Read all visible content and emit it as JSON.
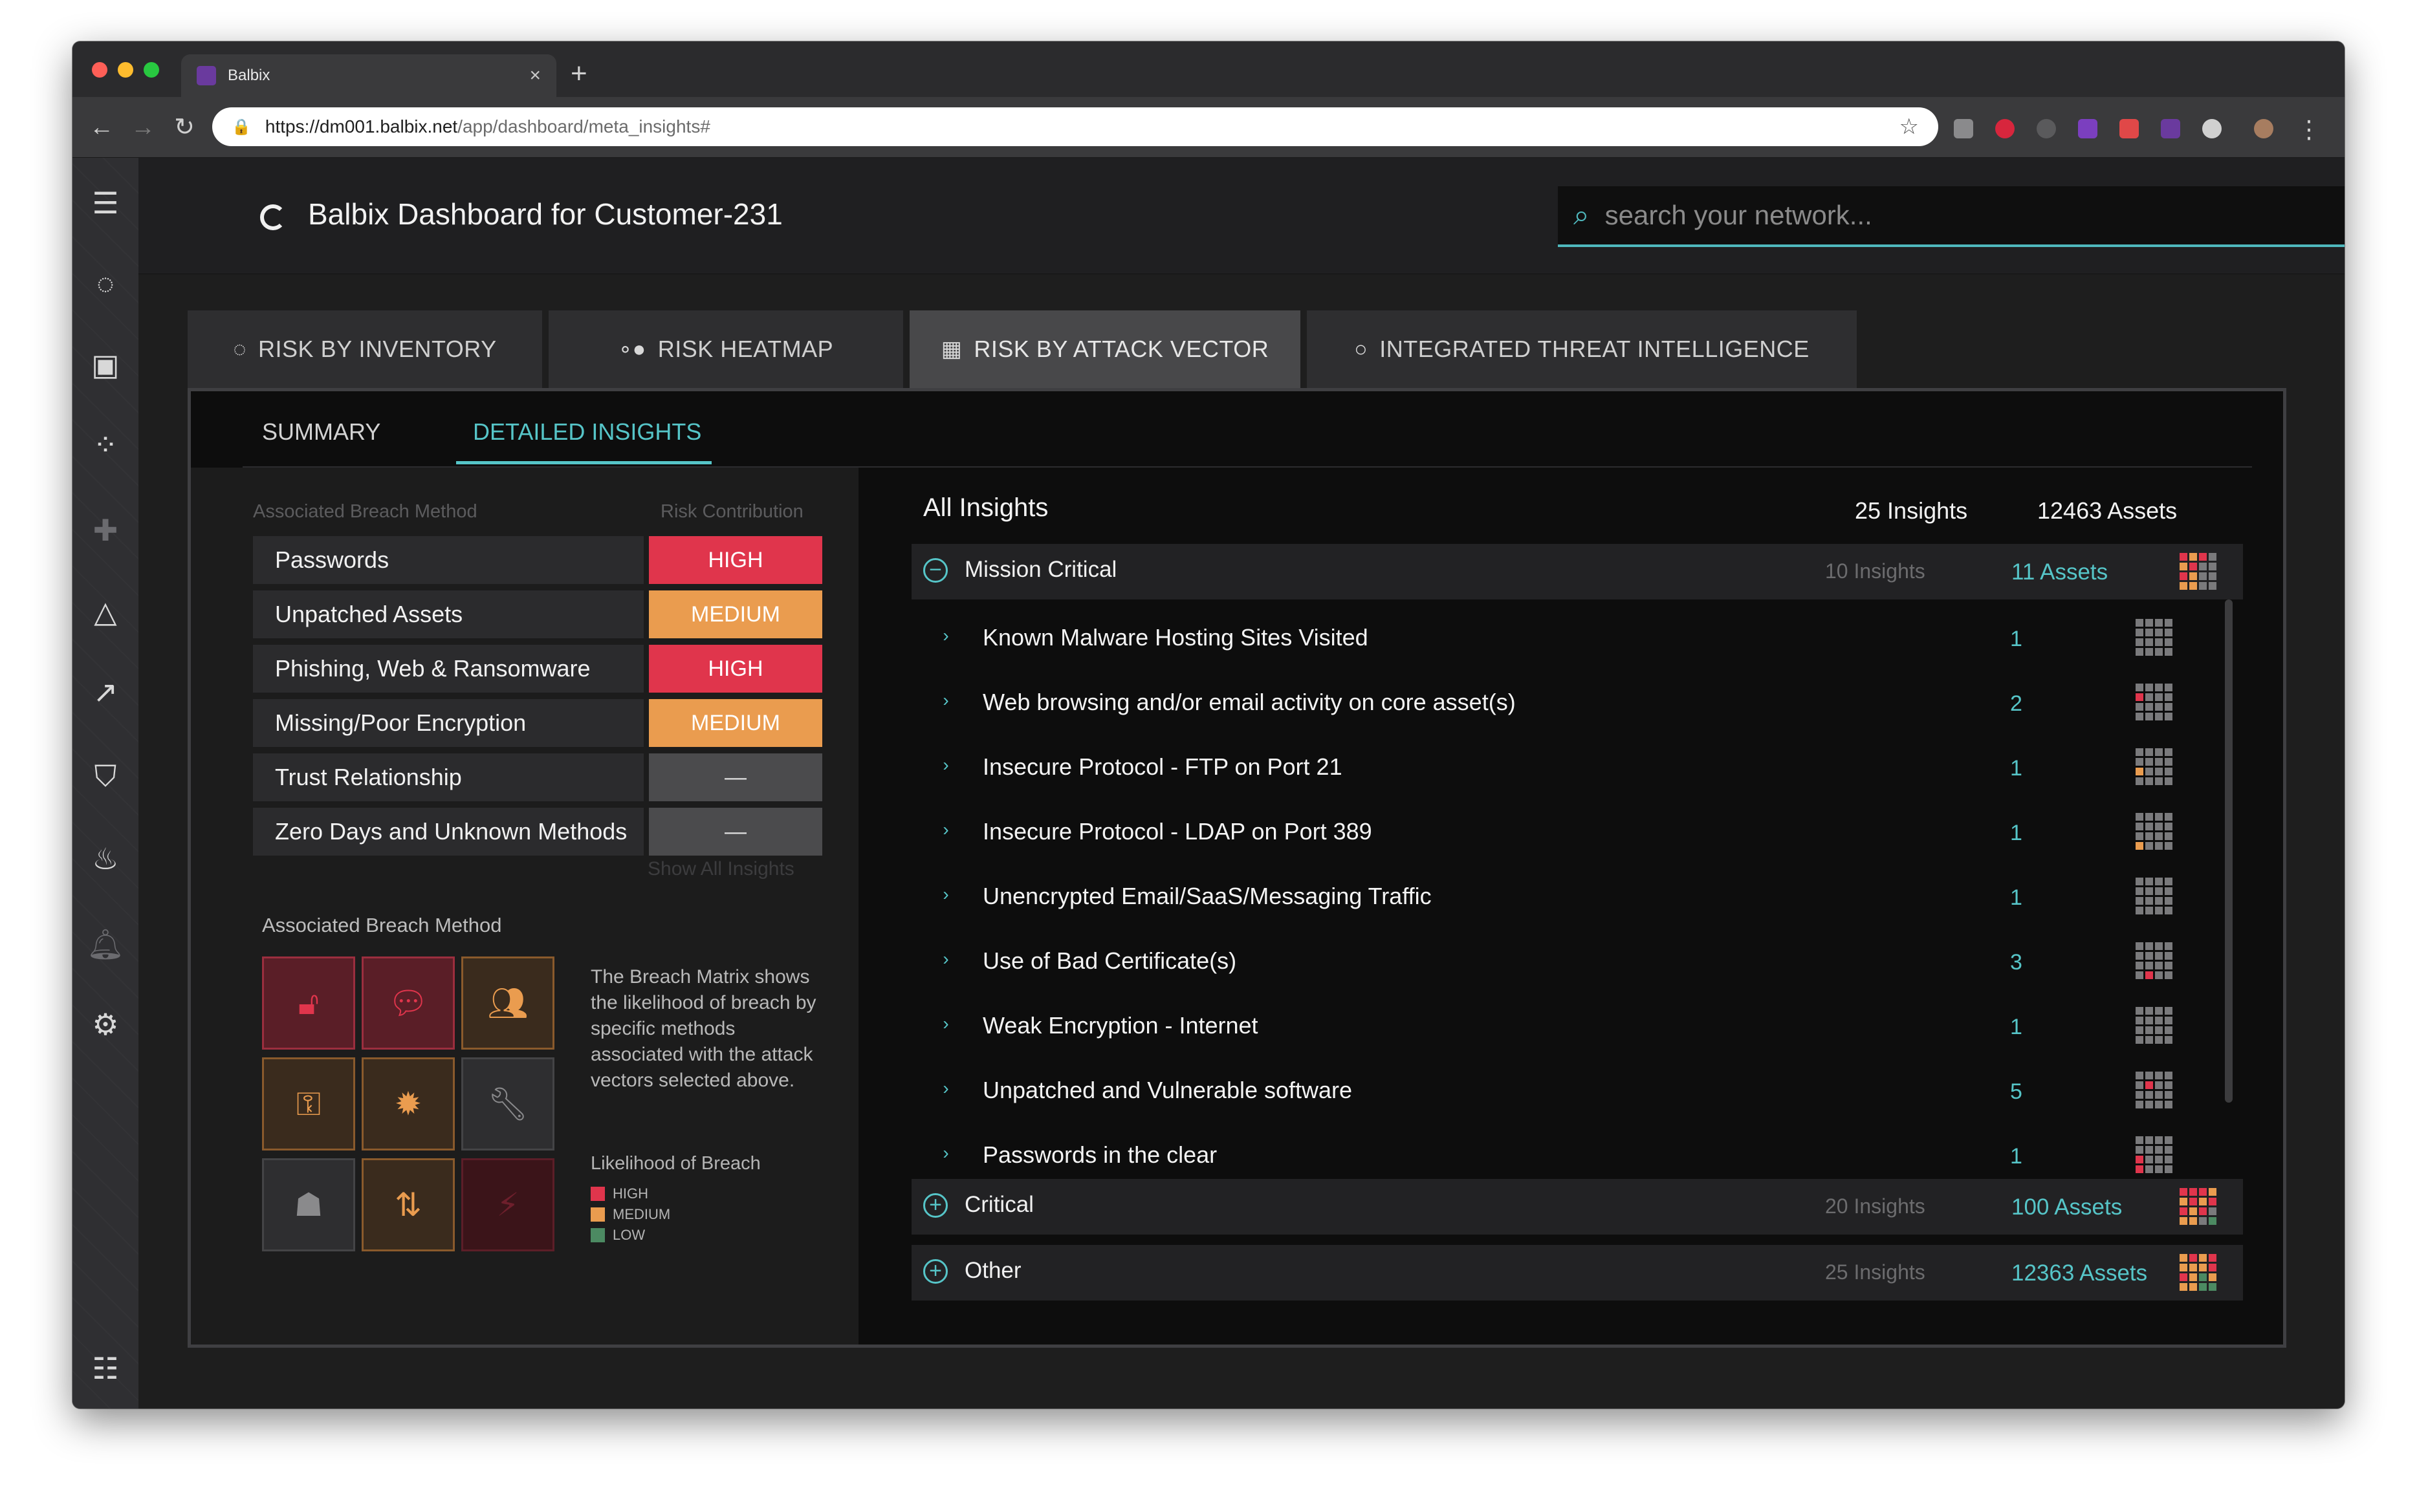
{
  "browser": {
    "tab_title": "Balbix",
    "tab_close": "×",
    "new_tab": "+",
    "url_host": "https://dm001.balbix.net",
    "url_path": "/app/dashboard/meta_insights#"
  },
  "header": {
    "title": "Balbix Dashboard for Customer-231",
    "search_placeholder": "search your network..."
  },
  "main_tabs": [
    {
      "label": "RISK BY INVENTORY",
      "icon": "refresh-circle-icon"
    },
    {
      "label": "RISK HEATMAP",
      "icon": "toggle-dots-icon"
    },
    {
      "label": "RISK BY ATTACK VECTOR",
      "icon": "grid-icon"
    },
    {
      "label": "INTEGRATED THREAT INTELLIGENCE",
      "icon": "circle-icon"
    }
  ],
  "sub_tabs": [
    {
      "label": "SUMMARY"
    },
    {
      "label": "DETAILED INSIGHTS"
    }
  ],
  "breach_methods": {
    "col_method": "Associated Breach Method",
    "col_risk": "Risk Contribution",
    "rows": [
      {
        "name": "Passwords",
        "level": "HIGH",
        "level_key": "HIGH"
      },
      {
        "name": "Unpatched Assets",
        "level": "MEDIUM",
        "level_key": "MEDIUM"
      },
      {
        "name": "Phishing, Web & Ransomware",
        "level": "HIGH",
        "level_key": "HIGH"
      },
      {
        "name": "Missing/Poor Encryption",
        "level": "MEDIUM",
        "level_key": "MEDIUM"
      },
      {
        "name": "Trust Relationship",
        "level": "—",
        "level_key": "NONE"
      },
      {
        "name": "Zero Days and Unknown Methods",
        "level": "—",
        "level_key": "NONE"
      }
    ],
    "show_all": "Show All Insights"
  },
  "matrix": {
    "label": "Associated Breach Method",
    "description": "The Breach Matrix shows the likelihood of breach by specific methods associated with the attack vectors selected above.",
    "likelihood_label": "Likelihood of Breach",
    "legend": [
      {
        "label": "HIGH",
        "color": "#e0354c"
      },
      {
        "label": "MEDIUM",
        "color": "#ea9c4f"
      },
      {
        "label": "LOW",
        "color": "#4c8a62"
      }
    ]
  },
  "insights": {
    "title": "All Insights",
    "total_insights": "25 Insights",
    "total_assets": "12463 Assets",
    "groups": [
      {
        "name": "Mission Critical",
        "toggle": "−",
        "insights": "10 Insights",
        "assets": "11 Assets"
      },
      {
        "name": "Critical",
        "toggle": "+",
        "insights": "20 Insights",
        "assets": "100 Assets"
      },
      {
        "name": "Other",
        "toggle": "+",
        "insights": "25 Insights",
        "assets": "12363 Assets"
      }
    ],
    "items": [
      {
        "name": "Known Malware Hosting Sites Visited",
        "count": "1"
      },
      {
        "name": "Web browsing and/or email activity on core asset(s)",
        "count": "2"
      },
      {
        "name": "Insecure Protocol - FTP on Port 21",
        "count": "1"
      },
      {
        "name": "Insecure Protocol - LDAP on Port 389",
        "count": "1"
      },
      {
        "name": "Unencrypted Email/SaaS/Messaging Traffic",
        "count": "1"
      },
      {
        "name": "Use of Bad Certificate(s)",
        "count": "3"
      },
      {
        "name": "Weak Encryption - Internet",
        "count": "1"
      },
      {
        "name": "Unpatched and Vulnerable software",
        "count": "5"
      },
      {
        "name": "Passwords in the clear",
        "count": "1"
      }
    ]
  }
}
